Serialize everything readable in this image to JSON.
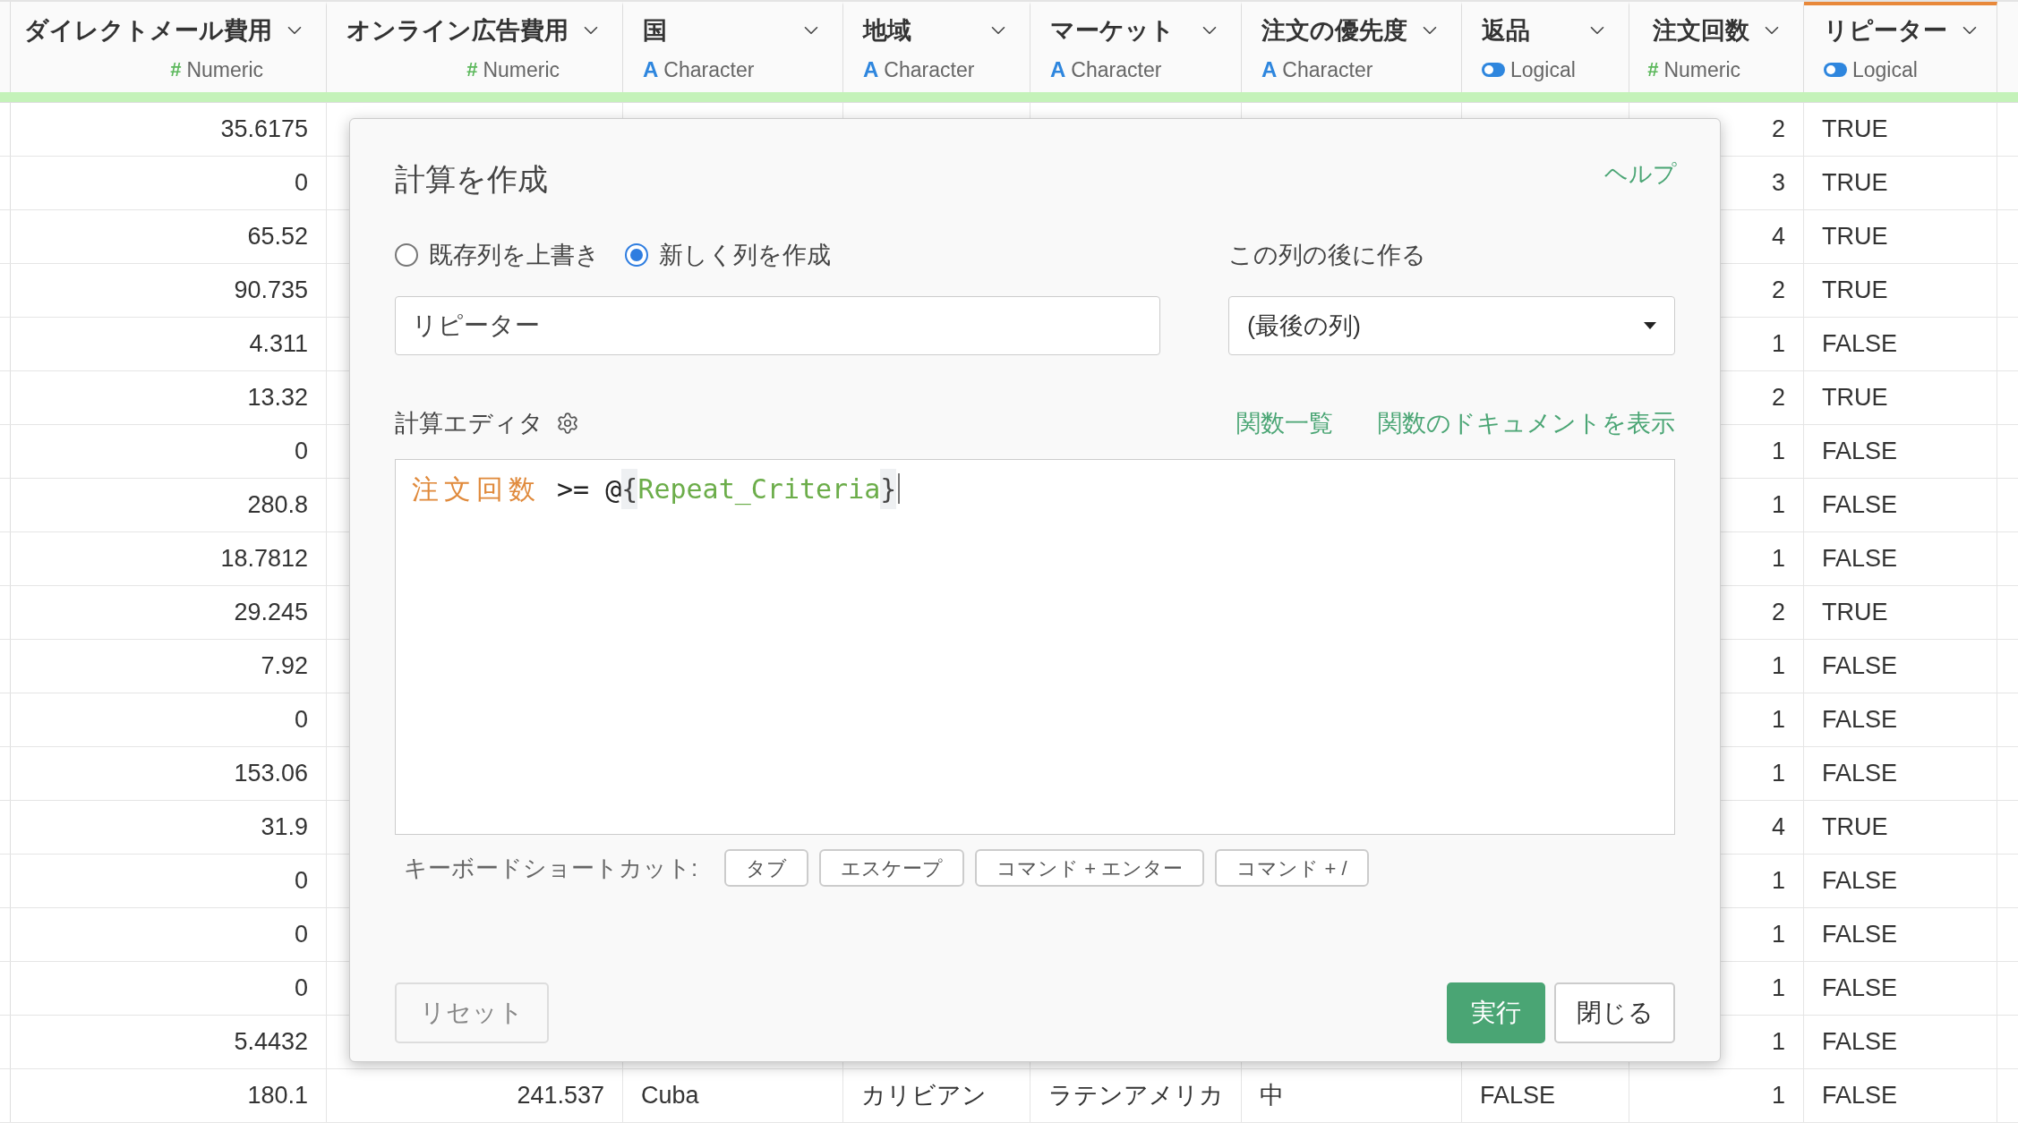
{
  "table": {
    "columns": [
      {
        "name": "ダイレクトメール費用",
        "kind": "numeric",
        "type_icon": "#",
        "type_label": "Numeric",
        "selected": false
      },
      {
        "name": "オンライン広告費用",
        "kind": "numeric",
        "type_icon": "#",
        "type_label": "Numeric",
        "selected": false
      },
      {
        "name": "国",
        "kind": "character",
        "type_icon": "A",
        "type_label": "Character",
        "selected": false
      },
      {
        "name": "地域",
        "kind": "character",
        "type_icon": "A",
        "type_label": "Character",
        "selected": false
      },
      {
        "name": "マーケット",
        "kind": "character",
        "type_icon": "A",
        "type_label": "Character",
        "selected": false
      },
      {
        "name": "注文の優先度",
        "kind": "character",
        "type_icon": "A",
        "type_label": "Character",
        "selected": false
      },
      {
        "name": "返品",
        "kind": "logical",
        "type_label": "Logical",
        "selected": false
      },
      {
        "name": "注文回数",
        "kind": "numeric",
        "type_icon": "#",
        "type_label": "Numeric",
        "selected": false
      },
      {
        "name": "リピーター",
        "kind": "logical",
        "type_label": "Logical",
        "selected": true
      }
    ],
    "rows": [
      {
        "cells": [
          "35.6175",
          "",
          "",
          "",
          "",
          "",
          "",
          "2",
          "TRUE"
        ]
      },
      {
        "cells": [
          "0",
          "",
          "",
          "",
          "",
          "",
          "",
          "3",
          "TRUE"
        ]
      },
      {
        "cells": [
          "65.52",
          "",
          "",
          "",
          "",
          "",
          "",
          "4",
          "TRUE"
        ]
      },
      {
        "cells": [
          "90.735",
          "",
          "",
          "",
          "",
          "",
          "",
          "2",
          "TRUE"
        ]
      },
      {
        "cells": [
          "4.311",
          "",
          "",
          "",
          "",
          "",
          "",
          "1",
          "FALSE"
        ]
      },
      {
        "cells": [
          "13.32",
          "",
          "",
          "",
          "",
          "",
          "",
          "2",
          "TRUE"
        ]
      },
      {
        "cells": [
          "0",
          "",
          "",
          "",
          "",
          "",
          "",
          "1",
          "FALSE"
        ]
      },
      {
        "cells": [
          "280.8",
          "",
          "",
          "",
          "",
          "",
          "",
          "1",
          "FALSE"
        ]
      },
      {
        "cells": [
          "18.7812",
          "",
          "",
          "",
          "",
          "",
          "",
          "1",
          "FALSE"
        ]
      },
      {
        "cells": [
          "29.245",
          "",
          "",
          "",
          "",
          "",
          "",
          "2",
          "TRUE"
        ]
      },
      {
        "cells": [
          "7.92",
          "",
          "",
          "",
          "",
          "",
          "",
          "1",
          "FALSE"
        ]
      },
      {
        "cells": [
          "0",
          "",
          "",
          "",
          "",
          "",
          "",
          "1",
          "FALSE"
        ]
      },
      {
        "cells": [
          "153.06",
          "",
          "",
          "",
          "",
          "",
          "",
          "1",
          "FALSE"
        ]
      },
      {
        "cells": [
          "31.9",
          "",
          "",
          "",
          "",
          "",
          "",
          "4",
          "TRUE"
        ]
      },
      {
        "cells": [
          "0",
          "",
          "",
          "",
          "",
          "",
          "",
          "1",
          "FALSE"
        ]
      },
      {
        "cells": [
          "0",
          "",
          "",
          "",
          "",
          "",
          "",
          "1",
          "FALSE"
        ]
      },
      {
        "cells": [
          "0",
          "",
          "",
          "",
          "",
          "",
          "",
          "1",
          "FALSE"
        ]
      },
      {
        "cells": [
          "5.4432",
          "",
          "",
          "",
          "",
          "",
          "",
          "1",
          "FALSE"
        ]
      },
      {
        "cells": [
          "180.1",
          "241.537",
          "Cuba",
          "カリビアン",
          "ラテンアメリカ",
          "中",
          "FALSE",
          "1",
          "FALSE"
        ]
      }
    ]
  },
  "dialog": {
    "title": "計算を作成",
    "help_link": "ヘルプ",
    "modes": [
      {
        "label": "既存列を上書き",
        "selected": false
      },
      {
        "label": "新しく列を作成",
        "selected": true
      }
    ],
    "column_name": {
      "value": "リピーター"
    },
    "position": {
      "label": "この列の後に作る",
      "value": "(最後の列)"
    },
    "editor": {
      "label": "計算エディタ",
      "links": [
        "関数一覧",
        "関数のドキュメントを表示"
      ],
      "tokens": [
        {
          "text": "注文回数",
          "kind": "column"
        },
        {
          "text": " >= @",
          "kind": "operator"
        },
        {
          "text": "{",
          "kind": "bracket"
        },
        {
          "text": "Repeat_Criteria",
          "kind": "parameter"
        },
        {
          "text": "}",
          "kind": "bracket"
        }
      ]
    },
    "shortcuts": {
      "label": "キーボードショートカット:",
      "keys": [
        "タブ",
        "エスケープ",
        "コマンド + エンター",
        "コマンド + /"
      ]
    },
    "buttons": {
      "reset": "リセット",
      "run": "実行",
      "close": "閉じる"
    }
  }
}
